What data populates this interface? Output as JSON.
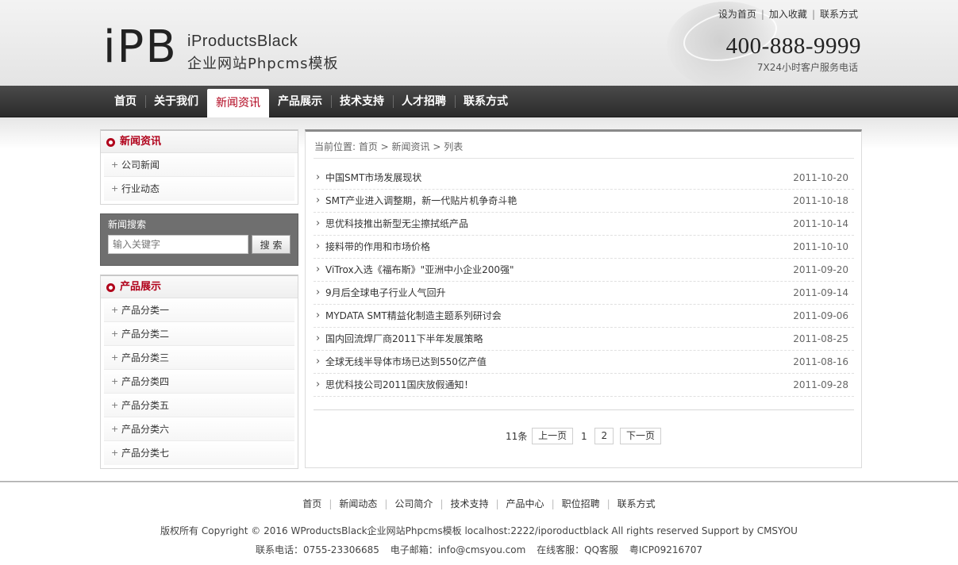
{
  "header": {
    "logo_mark": "iPB",
    "logo_name": "iProductsBlack",
    "logo_sub": "企业网站Phpcms模板",
    "top_links": [
      "设为首页",
      "加入收藏",
      "联系方式"
    ],
    "phone": "400-888-9999",
    "phone_sub": "7X24小时客户服务电话"
  },
  "nav": {
    "items": [
      "首页",
      "关于我们",
      "新闻资讯",
      "产品展示",
      "技术支持",
      "人才招聘",
      "联系方式"
    ],
    "active": "新闻资讯"
  },
  "sidebar": {
    "news": {
      "title": "新闻资讯",
      "items": [
        "公司新闻",
        "行业动态"
      ]
    },
    "search": {
      "title": "新闻搜索",
      "placeholder": "输入关键字",
      "button": "搜 索"
    },
    "products": {
      "title": "产品展示",
      "items": [
        "产品分类一",
        "产品分类二",
        "产品分类三",
        "产品分类四",
        "产品分类五",
        "产品分类六",
        "产品分类七"
      ]
    }
  },
  "main": {
    "breadcrumb": "当前位置: 首页 > 新闻资讯 > 列表",
    "news": [
      {
        "title": "中国SMT市场发展现状",
        "date": "2011-10-20"
      },
      {
        "title": "SMT产业进入调整期，新一代贴片机争奇斗艳",
        "date": "2011-10-18"
      },
      {
        "title": "思优科技推出新型无尘擦拭纸产品",
        "date": "2011-10-14"
      },
      {
        "title": "接料带的作用和市场价格",
        "date": "2011-10-10"
      },
      {
        "title": "ViTrox入选《福布斯》\"亚洲中小企业200强\"",
        "date": "2011-09-20"
      },
      {
        "title": "9月后全球电子行业人气回升",
        "date": "2011-09-14"
      },
      {
        "title": "MYDATA SMT精益化制造主题系列研讨会",
        "date": "2011-09-06"
      },
      {
        "title": "国内回流焊厂商2011下半年发展策略",
        "date": "2011-08-25"
      },
      {
        "title": "全球无线半导体市场已达到550亿产值",
        "date": "2011-08-16"
      },
      {
        "title": "思优科技公司2011国庆放假通知！",
        "date": "2011-09-28"
      }
    ],
    "pager": {
      "total": "11条",
      "prev": "上一页",
      "current": "1",
      "page2": "2",
      "next": "下一页"
    }
  },
  "footer": {
    "links": [
      "首页",
      "新闻动态",
      "公司简介",
      "技术支持",
      "产品中心",
      "职位招聘",
      "联系方式"
    ],
    "copyright": "版权所有 Copyright © 2016 WProductsBlack企业网站Phpcms模板 localhost:2222/iporoductblack    All rights reserved    Support by CMSYOU",
    "tel": "联系电话：0755-23306685",
    "email": "电子邮箱：info@cmsyou.com",
    "service": "在线客服：QQ客服",
    "icp": "粤ICP09216707"
  },
  "colors": {
    "accent": "#b0001a",
    "nav_dark": "#2b2b2b",
    "search_bg": "#6f6f6f"
  }
}
